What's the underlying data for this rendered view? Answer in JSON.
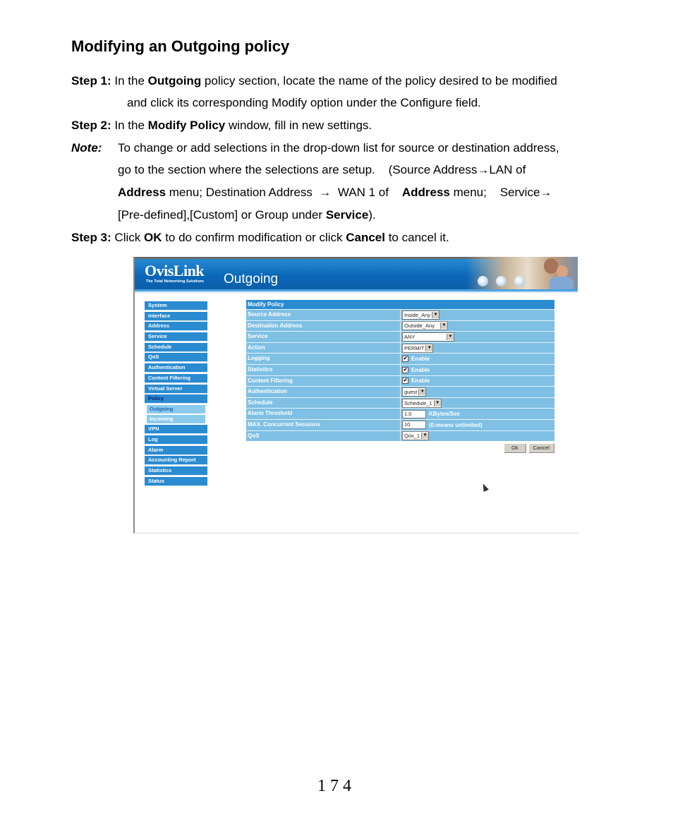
{
  "document": {
    "title": "Modifying an Outgoing policy",
    "step1": {
      "label": "Step 1:",
      "t1": " In the ",
      "b1": "Outgoing",
      "t2": " policy section, locate the name of the policy desired to be modified",
      "line2": "and click its corresponding Modify option under the Configure field."
    },
    "step2": {
      "label": "Step 2:",
      "t1": " In the ",
      "b1": "Modify Policy",
      "t2": " window, fill in new settings."
    },
    "note": {
      "label": "Note:",
      "line1": "To change or add selections in the drop-down list for source or destination address,",
      "line2": "go to the section where the selections are setup.    (Source Address→LAN of",
      "line3_b1": "Address",
      "line3_t1": " menu; Destination Address  →  WAN 1 of    ",
      "line3_b2": "Address",
      "line3_t2": " menu;    Service→",
      "line4_t1": "[Pre-defined],[Custom] or Group under ",
      "line4_b1": "Service",
      "line4_t2": ")."
    },
    "step3": {
      "label": "Step 3:",
      "t1": " Click ",
      "b1": "OK",
      "t2": " to do confirm modification or click ",
      "b2": "Cancel",
      "t3": " to cancel it."
    },
    "page_number": "174"
  },
  "screenshot": {
    "brand": "OvisLink",
    "tagline": "The Total Networking Solutions",
    "page_title": "Outgoing",
    "colors": {
      "nav_bg": "#2a8bd1",
      "row_bg": "#7fc0e4",
      "active_text": "#0b1f7a"
    },
    "nav": {
      "items_top": [
        "System",
        "Interface",
        "Address",
        "Service",
        "Schedule",
        "QoS",
        "Authentication",
        "Content Filtering",
        "Virtual Server",
        "Policy"
      ],
      "sub_items": [
        "Outgoing",
        "Incoming"
      ],
      "items_bottom": [
        "VPN",
        "Log",
        "Alarm",
        "Accounting Report",
        "Statistics",
        "Status"
      ]
    },
    "form": {
      "header": "Modify Policy",
      "rows": {
        "source_address": {
          "label": "Source Address",
          "value": "Inside_Any"
        },
        "destination_address": {
          "label": "Destination Address",
          "value": "Outside_Any"
        },
        "service": {
          "label": "Service",
          "value": "ANY"
        },
        "action": {
          "label": "Action",
          "value": "PERMIT"
        },
        "logging": {
          "label": "Logging",
          "checkbox_label": "Enable",
          "checked": true
        },
        "statistics": {
          "label": "Statistics",
          "checkbox_label": "Enable",
          "checked": true
        },
        "content_filtering": {
          "label": "Content Filtering",
          "checkbox_label": "Enable",
          "checked": true
        },
        "authentication": {
          "label": "Authentication",
          "value": "guest"
        },
        "schedule": {
          "label": "Schedule",
          "value": "Schedule_1"
        },
        "alarm_threshold": {
          "label": "Alarm Threshold",
          "value": "1.0",
          "unit": "KBytes/Sec"
        },
        "max_sessions": {
          "label": "MAX. Concurrent Sessions",
          "value": "10",
          "hint": "(0:means unlimited)"
        },
        "qos": {
          "label": "QoS",
          "value": "Qos_1"
        }
      },
      "ok_label": "Ok",
      "cancel_label": "Cancel",
      "check_glyph": "✔",
      "arrow_glyph": "▼"
    }
  }
}
